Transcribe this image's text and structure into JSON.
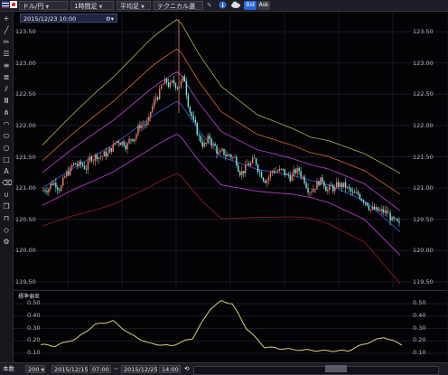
{
  "toolbar": {
    "symbol": "ドル/円",
    "timeframe": "1時間足",
    "avg_label": "平均足",
    "tech_label": "テクニカル選択",
    "bid_label": "Bid",
    "ask_label": "Ask"
  },
  "chart": {
    "date_label": "2015/12/23 10:00",
    "price_ticks": [
      "123.50",
      "123.00",
      "122.50",
      "122.00",
      "121.50",
      "121.00",
      "120.50",
      "120.00",
      "119.50"
    ],
    "indicator_label": "標準偏差",
    "indicator_ticks": [
      "0.50",
      "0.40",
      "0.30",
      "0.20",
      "0.10"
    ]
  },
  "bottom": {
    "period_label": "本数",
    "period_value": "200",
    "from_date": "2015/12/15",
    "from_time": "07:00",
    "to_date": "2015/12/25",
    "to_time": "14:00"
  },
  "colors": {
    "candle_up": "#e8826a",
    "candle_down": "#7fe8e0",
    "band_outer": "#9aa040",
    "band_mid": "#c85a2a",
    "band_inner": "#b03cc0",
    "band_center": "#4050c0",
    "band_lowest": "#8a1a1a",
    "indicator_line": "#d8d070"
  },
  "icons": [
    "plus-icon",
    "line-icon",
    "pencil-icon",
    "horizontal-lines-icon",
    "fib-icon",
    "channel-icon",
    "bars-icon",
    "arc-icon",
    "ellipse-icon",
    "circle-icon",
    "rectangle-icon",
    "text-icon",
    "trash-icon",
    "magnet-icon",
    "copy-icon",
    "lock-icon",
    "eraser-icon",
    "settings-icon"
  ]
}
